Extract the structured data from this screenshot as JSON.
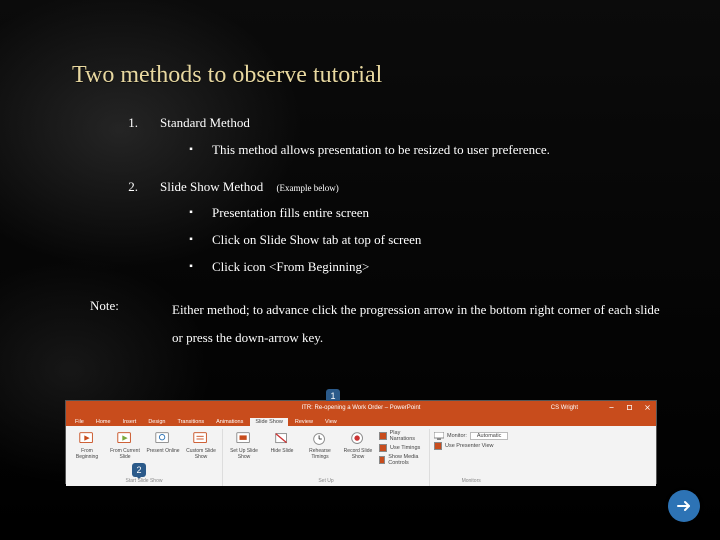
{
  "title": "Two methods to observe tutorial",
  "items": [
    {
      "num": "1.",
      "label": "Standard Method",
      "inline": "",
      "subs": [
        "This method allows presentation to be resized  to user preference."
      ]
    },
    {
      "num": "2.",
      "label": "Slide Show Method",
      "inline": "(Example below)",
      "subs": [
        "Presentation fills entire screen",
        "Click on Slide Show tab at top of screen",
        "Click icon <From Beginning>"
      ]
    }
  ],
  "note_label": "Note:",
  "note_text": "Either method; to advance click the progression arrow in the bottom right corner of each slide or press the down-arrow key.",
  "callouts": {
    "one": "1",
    "two": "2"
  },
  "ppt": {
    "window_title": "ITR:  Re-opening a Work Order – PowerPoint",
    "user": "CS Wright",
    "tabs": [
      "File",
      "Home",
      "Insert",
      "Design",
      "Transitions",
      "Animations",
      "Slide Show",
      "Review",
      "View"
    ],
    "active_tab": 6,
    "ribbon": {
      "start": {
        "from_beginning": "From Beginning",
        "from_current": "From Current Slide",
        "present_online": "Present Online",
        "custom": "Custom Slide Show",
        "group": "Start Slide Show"
      },
      "setup": {
        "setup": "Set Up Slide Show",
        "hide": "Hide Slide",
        "rehearse": "Rehearse Timings",
        "record": "Record Slide Show",
        "opts": [
          "Play Narrations",
          "Use Timings",
          "Show Media Controls"
        ],
        "group": "Set Up"
      },
      "monitors": {
        "monitor_label": "Monitor:",
        "monitor_value": "Automatic",
        "presenter": "Use Presenter View",
        "group": "Monitors"
      }
    }
  }
}
